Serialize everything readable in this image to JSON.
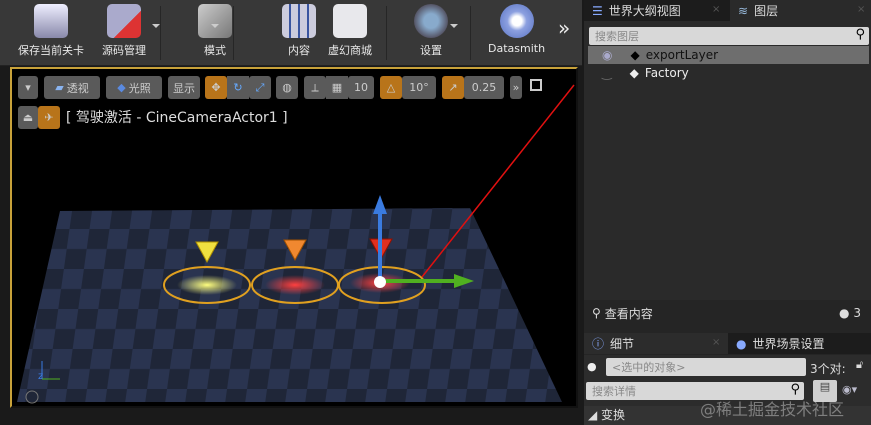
{
  "toolbar": {
    "items": [
      {
        "label": "保存当前关卡",
        "icon": "save-floppy-icon"
      },
      {
        "label": "源码管理",
        "icon": "source-control-icon"
      },
      {
        "label": "模式",
        "icon": "modes-wrench-icon"
      },
      {
        "label": "内容",
        "icon": "content-grid-icon"
      },
      {
        "label": "虚幻商城",
        "icon": "marketplace-bag-icon"
      },
      {
        "label": "设置",
        "icon": "settings-gear-icon"
      },
      {
        "label": "Datasmith",
        "icon": "datasmith-plug-icon"
      }
    ],
    "more": "»"
  },
  "viewport": {
    "perspective": "透视",
    "lighting": "光照",
    "show": "显示",
    "grid_snap": "10",
    "rotate_snap": "10°",
    "scale_snap": "0.25",
    "pilot_label": "[ 驾驶激活 - CineCameraActor1 ]",
    "more": "»"
  },
  "layers_panel": {
    "tabs": [
      {
        "label": "世界大纲视图"
      },
      {
        "label": "图层"
      }
    ],
    "search_placeholder": "搜索图层",
    "layers": [
      {
        "name": "exportLayer",
        "visible": true,
        "selected": true
      },
      {
        "name": "Factory",
        "visible": false,
        "selected": false
      }
    ],
    "view_content": "查看内容",
    "count": "3"
  },
  "details_panel": {
    "tabs": [
      {
        "label": "细节"
      },
      {
        "label": "世界场景设置"
      }
    ],
    "selected_placeholder": "<选中的对象>",
    "selected_count": "3个对:",
    "search_placeholder": "搜索详情",
    "section": "变换"
  },
  "watermark": "@稀土掘金技术社区",
  "colors": {
    "accent": "#b8741a",
    "selection": "#c8a23a",
    "arrow": "#e01010"
  }
}
